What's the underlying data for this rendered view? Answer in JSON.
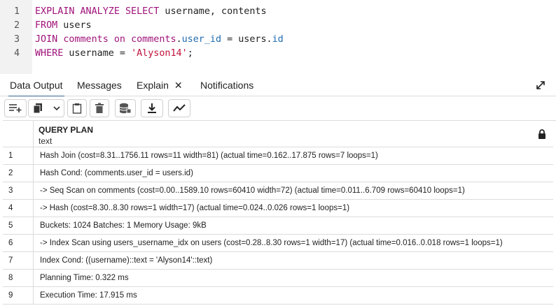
{
  "editor": {
    "lines": [
      {
        "num": "1",
        "tokens": [
          {
            "t": "EXPLAIN ANALYZE SELECT",
            "c": "kw"
          },
          {
            "t": " username, contents",
            "c": "plain"
          }
        ]
      },
      {
        "num": "2",
        "tokens": [
          {
            "t": "FROM",
            "c": "kw"
          },
          {
            "t": " users",
            "c": "plain"
          }
        ]
      },
      {
        "num": "3",
        "tokens": [
          {
            "t": "JOIN",
            "c": "kw"
          },
          {
            "t": " ",
            "c": "plain"
          },
          {
            "t": "comments",
            "c": "tbl"
          },
          {
            "t": " ",
            "c": "plain"
          },
          {
            "t": "on",
            "c": "kw"
          },
          {
            "t": " ",
            "c": "plain"
          },
          {
            "t": "comments",
            "c": "tbl"
          },
          {
            "t": ".",
            "c": "plain"
          },
          {
            "t": "user_id",
            "c": "col"
          },
          {
            "t": " = users.",
            "c": "plain"
          },
          {
            "t": "id",
            "c": "col"
          }
        ]
      },
      {
        "num": "4",
        "tokens": [
          {
            "t": "WHERE",
            "c": "kw"
          },
          {
            "t": " username = ",
            "c": "plain"
          },
          {
            "t": "'Alyson14'",
            "c": "str"
          },
          {
            "t": ";",
            "c": "plain"
          }
        ]
      }
    ]
  },
  "tabs": {
    "data_output": "Data Output",
    "messages": "Messages",
    "explain": "Explain",
    "explain_close": "✕",
    "notifications": "Notifications"
  },
  "toolbar": {
    "icons": [
      "add-row-icon",
      "copy-icon",
      "paste-icon",
      "delete-icon",
      "save-data-icon",
      "download-icon",
      "graph-visualiser-icon"
    ]
  },
  "grid": {
    "column_name": "QUERY PLAN",
    "column_type": "text",
    "rows": [
      {
        "n": "1",
        "v": "Hash Join  (cost=8.31..1756.11 rows=11 width=81) (actual time=0.162..17.875 rows=7 loops=1)"
      },
      {
        "n": "2",
        "v": "Hash Cond: (comments.user_id = users.id)"
      },
      {
        "n": "3",
        "v": "->  Seq Scan on comments  (cost=0.00..1589.10 rows=60410 width=72) (actual time=0.011..6.709 rows=60410 loops=1)"
      },
      {
        "n": "4",
        "v": "->  Hash  (cost=8.30..8.30 rows=1 width=17) (actual time=0.024..0.026 rows=1 loops=1)"
      },
      {
        "n": "5",
        "v": "Buckets: 1024  Batches: 1  Memory Usage: 9kB"
      },
      {
        "n": "6",
        "v": "->  Index Scan using users_username_idx on users  (cost=0.28..8.30 rows=1 width=17) (actual time=0.016..0.018 rows=1 loops=1)"
      },
      {
        "n": "7",
        "v": "Index Cond: ((username)::text = 'Alyson14'::text)"
      },
      {
        "n": "8",
        "v": "Planning Time: 0.322 ms"
      },
      {
        "n": "9",
        "v": "Execution Time: 17.915 ms"
      }
    ]
  },
  "colors": {
    "keyword": "#a0127a",
    "identifier": "#1f6bb0",
    "string": "#c0143c",
    "active_tab_underline": "#326690"
  }
}
